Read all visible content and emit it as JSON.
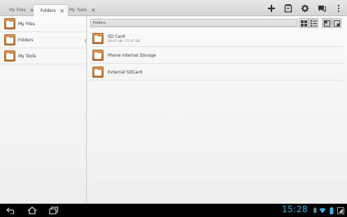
{
  "tabs": [
    {
      "label": "My Files",
      "active": false
    },
    {
      "label": "Folders",
      "active": true
    },
    {
      "label": "My Tools",
      "active": false
    }
  ],
  "tab_close_glyph": "×",
  "actions": [
    "add-icon",
    "sd-card-icon",
    "settings-gear-icon",
    "feedback-icon",
    "overflow-menu-icon"
  ],
  "left_nav": [
    {
      "label": "My Files"
    },
    {
      "label": "Folders"
    },
    {
      "label": "My Tools"
    }
  ],
  "path_label": "Folders",
  "view_buttons": [
    "grid-view-icon",
    "list-view-icon",
    "single-pane-icon",
    "dual-pane-icon"
  ],
  "folders": [
    {
      "name": "SD Card",
      "detail": "24.67 GB / 27.67 GB"
    },
    {
      "name": "Phone Internal Storage",
      "detail": ""
    },
    {
      "name": "External SDCard",
      "detail": ""
    }
  ],
  "status": {
    "time": "15:28"
  },
  "colors": {
    "accent": "#35b5e5",
    "folder": "#c98443",
    "system_bar": "#000000"
  }
}
